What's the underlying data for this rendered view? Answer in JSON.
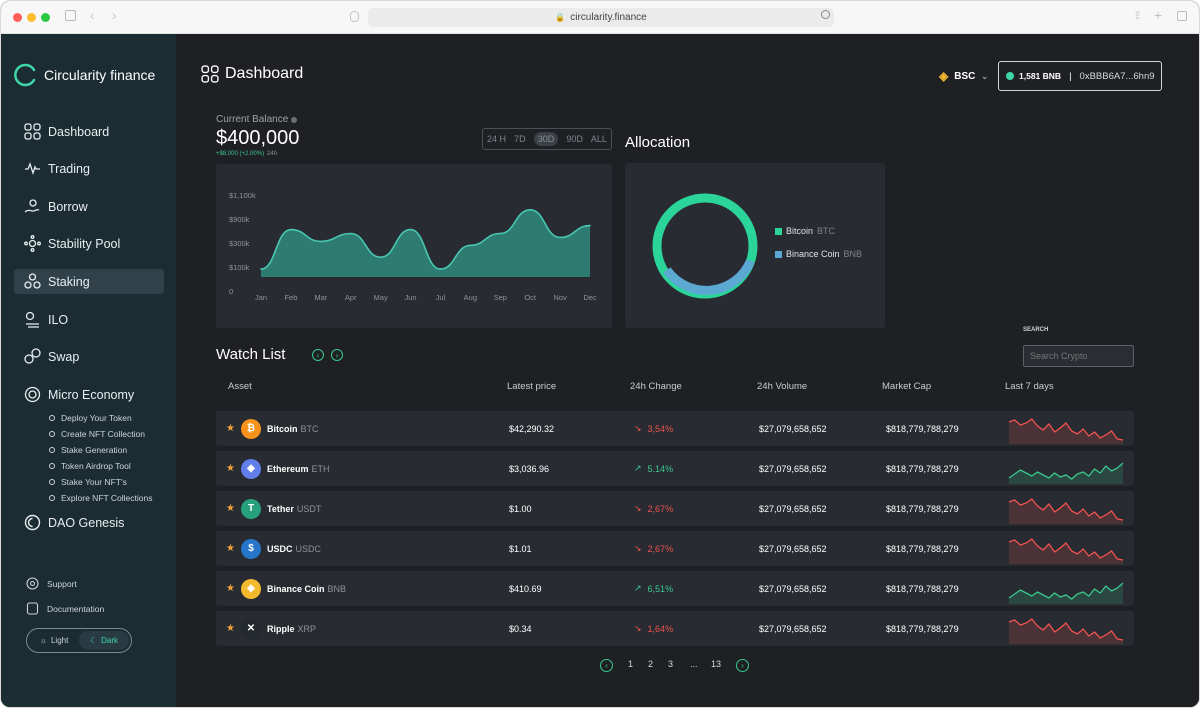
{
  "browser": {
    "url": "circularity.finance"
  },
  "brand": {
    "name": "Circularity finance"
  },
  "nav": [
    {
      "label": "Dashboard",
      "icon": "grid-icon"
    },
    {
      "label": "Trading",
      "icon": "pulse-icon"
    },
    {
      "label": "Borrow",
      "icon": "borrow-icon"
    },
    {
      "label": "Stability Pool",
      "icon": "stability-icon"
    },
    {
      "label": "Staking",
      "icon": "staking-icon"
    },
    {
      "label": "ILO",
      "icon": "ilo-icon"
    },
    {
      "label": "Swap",
      "icon": "swap-icon"
    },
    {
      "label": "Micro Economy",
      "icon": "micro-icon"
    }
  ],
  "micro_items": [
    "Deploy Your Token",
    "Create NFT Collection",
    "Stake Generation",
    "Token Airdrop Tool",
    "Stake Your NFT's",
    "Explore NFT Collections"
  ],
  "dao": {
    "label": "DAO Genesis"
  },
  "footer": {
    "support": "Support",
    "documentation": "Documentation",
    "light": "Light",
    "dark": "Dark"
  },
  "header": {
    "title": "Dashboard",
    "network": "BSC",
    "balance": "1,581 BNB",
    "separator": "|",
    "address": "0xBBB6A7...6hn9"
  },
  "balance": {
    "label": "Current Balance",
    "value": "$400,000",
    "change": "+$8,000 (+2.00%)",
    "period": "24h"
  },
  "ranges": [
    "24 H",
    "7D",
    "30D",
    "90D",
    "ALL"
  ],
  "allocation": {
    "title": "Allocation",
    "items": [
      {
        "name": "Bitcoin",
        "sym": "BTC"
      },
      {
        "name": "Binance Coin",
        "sym": "BNB"
      }
    ]
  },
  "chart_data": {
    "type": "area",
    "categories": [
      "Jan",
      "Feb",
      "Mar",
      "Apr",
      "May",
      "Jun",
      "Jul",
      "Aug",
      "Sep",
      "Oct",
      "Nov",
      "Dec"
    ],
    "y_tick_labels": [
      "0",
      "$100k",
      "$300k",
      "$900k",
      "$1,100k"
    ],
    "values": [
      100,
      600,
      450,
      550,
      250,
      600,
      100,
      400,
      550,
      850,
      500,
      650
    ],
    "colors": {
      "fill": "#2f8a7e",
      "line": "#49c7b2"
    }
  },
  "watchlist": {
    "title": "Watch List",
    "search_label": "SEARCH",
    "search_placeholder": "Search Crypto",
    "columns": [
      "Asset",
      "Latest price",
      "24h Change",
      "24h Volume",
      "Market Cap",
      "Last 7 days"
    ],
    "rows": [
      {
        "name": "Bitcoin",
        "sym": "BTC",
        "price": "$42,290.32",
        "change": "3,54%",
        "dir": "down",
        "volume": "$27,079,658,652",
        "cap": "$818,779,788,279",
        "color": "#f7931a",
        "glyph": "₿"
      },
      {
        "name": "Ethereum",
        "sym": "ETH",
        "price": "$3,036.96",
        "change": "5.14%",
        "dir": "up",
        "volume": "$27,079,658,652",
        "cap": "$818,779,788,279",
        "color": "#627eea",
        "glyph": "◆"
      },
      {
        "name": "Tether",
        "sym": "USDT",
        "price": "$1.00",
        "change": "2,67%",
        "dir": "down",
        "volume": "$27,079,658,652",
        "cap": "$818,779,788,279",
        "color": "#26a17b",
        "glyph": "T"
      },
      {
        "name": "USDC",
        "sym": "USDC",
        "price": "$1.01",
        "change": "2,67%",
        "dir": "down",
        "volume": "$27,079,658,652",
        "cap": "$818,779,788,279",
        "color": "#2775ca",
        "glyph": "$"
      },
      {
        "name": "Binance Coin",
        "sym": "BNB",
        "price": "$410.69",
        "change": "6,51%",
        "dir": "up",
        "volume": "$27,079,658,652",
        "cap": "$818,779,788,279",
        "color": "#f3ba2f",
        "glyph": "◈"
      },
      {
        "name": "Ripple",
        "sym": "XRP",
        "price": "$0.34",
        "change": "1,64%",
        "dir": "down",
        "volume": "$27,079,658,652",
        "cap": "$818,779,788,279",
        "color": "#23292f",
        "glyph": "✕"
      }
    ],
    "pages": [
      "1",
      "2",
      "3",
      "...",
      "13"
    ]
  },
  "colors": {
    "up": "#39c98d",
    "down": "#ef5350",
    "accent": "#3fd7a8"
  }
}
